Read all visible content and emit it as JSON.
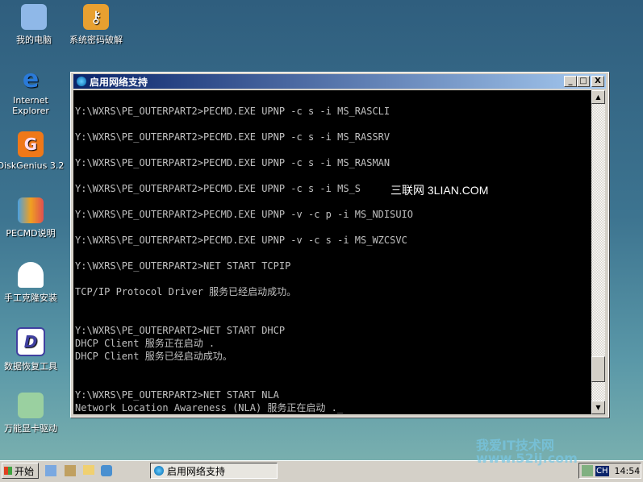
{
  "desktop": {
    "icons": [
      {
        "label": "我的电脑",
        "icon": "computer-icon",
        "color": "#8fb8e8"
      },
      {
        "label": "系统密码破解",
        "icon": "key-icon",
        "color": "#e8a030"
      },
      {
        "label": "Internet Explorer",
        "icon": "ie-icon",
        "color": "#2a7ad8"
      },
      {
        "label": "DiskGenius 3.2",
        "icon": "diskgenius-icon",
        "color": "#f07818"
      },
      {
        "label": "PECMD说明",
        "icon": "help-icon",
        "color": "#e05050"
      },
      {
        "label": "手工克隆安装",
        "icon": "ghost-icon",
        "color": "#ffffff"
      },
      {
        "label": "数据恢复工具",
        "icon": "recovery-icon",
        "color": "#4040a0"
      },
      {
        "label": "万能显卡驱动",
        "icon": "driver-icon",
        "color": "#50a050"
      }
    ]
  },
  "window": {
    "title": "启用网络支持",
    "min": "_",
    "max": "□",
    "close": "X"
  },
  "console": {
    "lines": [
      "Y:\\WXRS\\PE_OUTERPART2>PECMD.EXE UPNP -c s -i MS_RASCLI",
      "Y:\\WXRS\\PE_OUTERPART2>PECMD.EXE UPNP -c s -i MS_RASSRV",
      "Y:\\WXRS\\PE_OUTERPART2>PECMD.EXE UPNP -c s -i MS_RASMAN",
      "Y:\\WXRS\\PE_OUTERPART2>PECMD.EXE UPNP -c s -i MS_S",
      "Y:\\WXRS\\PE_OUTERPART2>PECMD.EXE UPNP -v -c p -i MS_NDISUIO",
      "Y:\\WXRS\\PE_OUTERPART2>PECMD.EXE UPNP -v -c s -i MS_WZCSVC",
      "Y:\\WXRS\\PE_OUTERPART2>NET START TCPIP",
      "TCP/IP Protocol Driver 服务已经启动成功。",
      "Y:\\WXRS\\PE_OUTERPART2>NET START DHCP",
      "DHCP Client 服务正在启动 .",
      "DHCP Client 服务已经启动成功。",
      "Y:\\WXRS\\PE_OUTERPART2>NET START NLA",
      "Network Location Awareness (NLA) 服务正在启动 ._"
    ]
  },
  "watermark": "三联网 3LIAN.COM",
  "taskbar": {
    "start": "开始",
    "task": "启用网络支持",
    "lang": "CH",
    "clock": "14:54",
    "site_watermark": "我爱IT技术网 www.52ij.com"
  }
}
